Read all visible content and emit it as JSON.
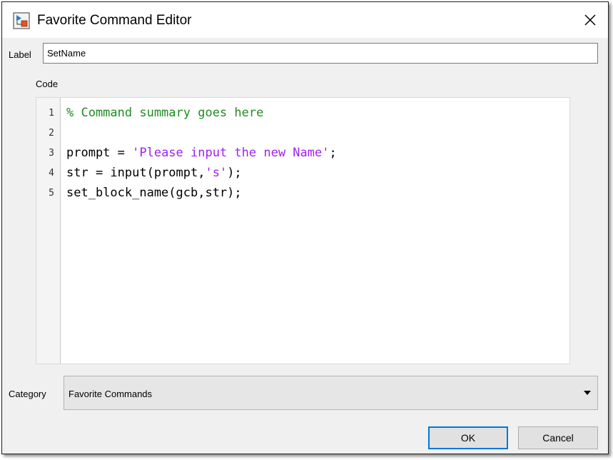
{
  "window": {
    "title": "Favorite Command Editor",
    "app_icon": "simulink-app-icon",
    "close_icon": "close-icon"
  },
  "label_field": {
    "label": "Label",
    "value": "SetName"
  },
  "code_section": {
    "label": "Code",
    "lines": [
      {
        "num": "1",
        "text": "% Command summary goes here"
      },
      {
        "num": "2",
        "text": ""
      },
      {
        "num": "3",
        "before": "prompt = ",
        "string": "'Please input the new Name'",
        "after": ";"
      },
      {
        "num": "4",
        "before": "str = input(prompt,",
        "string": "'s'",
        "after": ");"
      },
      {
        "num": "5",
        "text": "set_block_name(gcb,str);"
      }
    ]
  },
  "category_field": {
    "label": "Category",
    "value": "Favorite Commands",
    "arrow_icon": "dropdown-arrow-icon"
  },
  "buttons": {
    "ok": "OK",
    "cancel": "Cancel"
  },
  "colors": {
    "comment": "#228b22",
    "string": "#a020f0",
    "focus_border": "#0078d7"
  }
}
